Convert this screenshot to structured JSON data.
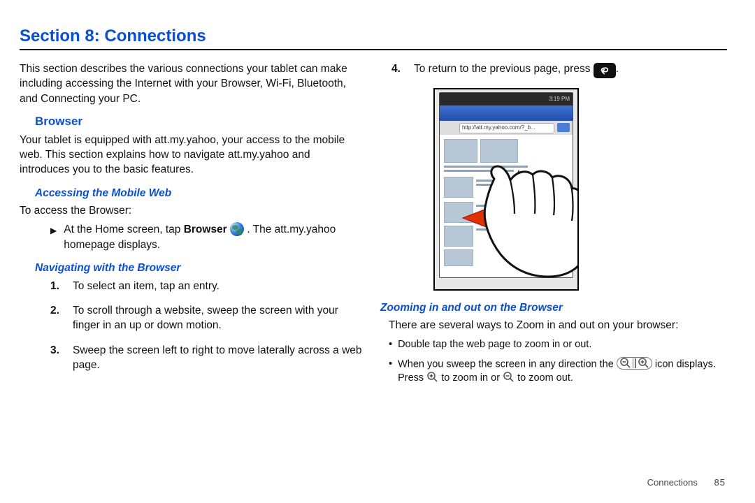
{
  "section": {
    "title": "Section 8: Connections"
  },
  "left": {
    "intro": "This section describes the various connections your tablet can make including accessing the Internet with your Browser, Wi-Fi, Bluetooth, and Connecting your PC.",
    "browser_h": "Browser",
    "browser_body": "Your tablet is equipped with att.my.yahoo, your access to the mobile web. This section explains how to navigate att.my.yahoo and introduces you to the basic features.",
    "access_h": "Accessing the Mobile Web",
    "access_intro": "To access the Browser:",
    "access_step_pre": "At the Home screen, tap ",
    "access_step_bold": "Browser",
    "access_step_post": " . The att.my.yahoo homepage displays.",
    "nav_h": "Navigating with the Browser",
    "nav_1": "To select an item, tap an entry.",
    "nav_2": "To scroll through a website, sweep the screen with your finger in an up or down motion.",
    "nav_3": "Sweep the screen left to right to move laterally across a web page."
  },
  "right": {
    "nav_4_pre": "To return to the previous page, press ",
    "nav_4_post": ".",
    "url_mock": "http://att.my.yahoo.com/?_b...",
    "status_time": "3:19 PM",
    "zoom_h": "Zooming in and out on the Browser",
    "zoom_intro": "There are several ways to Zoom in and out on your browser:",
    "zoom_b1": "Double tap the web page to zoom in or out.",
    "zoom_b2_pre": "When you sweep the screen in any direction the ",
    "zoom_b2_mid1": " icon displays. Press ",
    "zoom_b2_mid2": " to zoom in or ",
    "zoom_b2_post": " to zoom out."
  },
  "nums": {
    "n1": "1.",
    "n2": "2.",
    "n3": "3.",
    "n4": "4."
  },
  "footer": {
    "label": "Connections",
    "page": "85"
  }
}
